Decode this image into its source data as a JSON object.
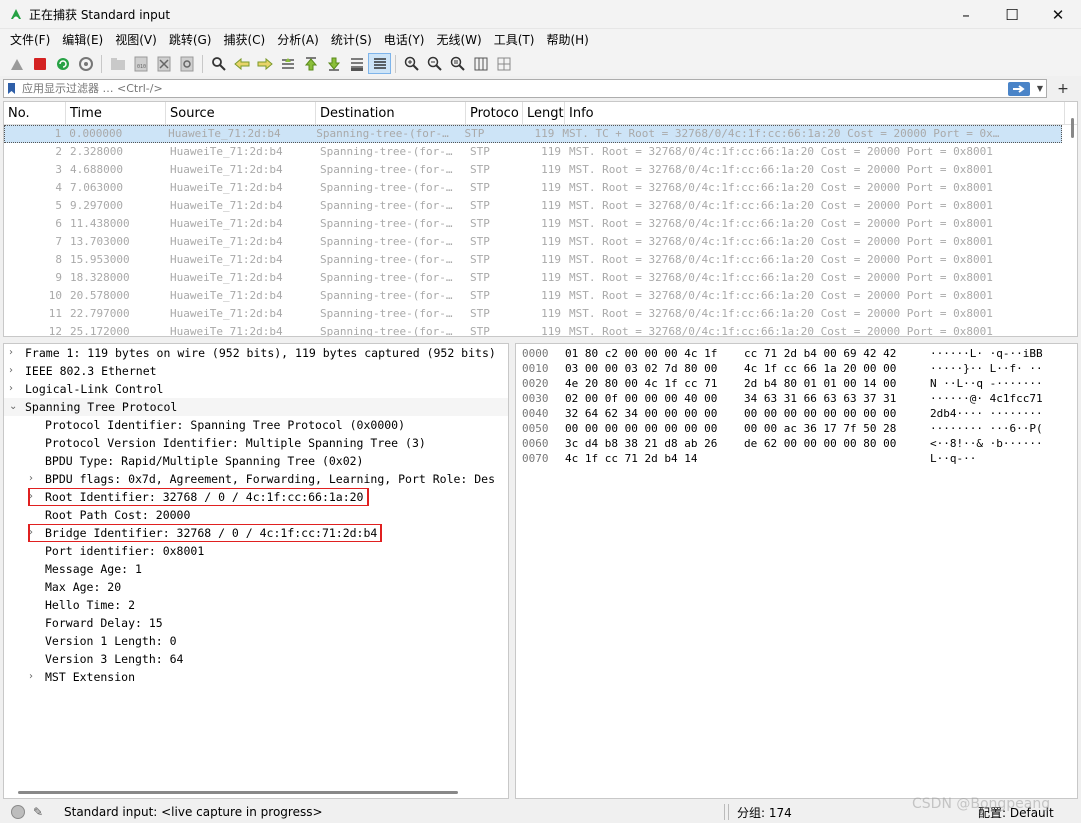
{
  "window": {
    "title": "正在捕获 Standard input",
    "minimize": "–",
    "maximize": "☐",
    "close": "✕",
    "icon": "shark-fin-icon",
    "accent": "#27a245"
  },
  "menu": [
    "文件(F)",
    "编辑(E)",
    "视图(V)",
    "跳转(G)",
    "捕获(C)",
    "分析(A)",
    "统计(S)",
    "电话(Y)",
    "无线(W)",
    "工具(T)",
    "帮助(H)"
  ],
  "toolbar_icons": [
    "start-capture-icon",
    "stop-capture-icon",
    "restart-capture-icon",
    "capture-options-icon",
    "open-file-icon",
    "save-file-icon",
    "close-file-icon",
    "reload-file-icon",
    "find-packet-icon",
    "go-back-icon",
    "go-forward-icon",
    "go-to-packet-icon",
    "first-packet-icon",
    "last-packet-icon",
    "auto-scroll-icon",
    "colorize-icon",
    "zoom-in-icon",
    "zoom-out-icon",
    "normal-size-icon",
    "resize-columns-icon",
    "layout-icon"
  ],
  "filter": {
    "placeholder": "应用显示过滤器 … <Ctrl-/>",
    "add_label": "+"
  },
  "packet_list": {
    "columns": [
      "No.",
      "Time",
      "Source",
      "Destination",
      "Protoco",
      "Lengt",
      "Info"
    ],
    "rows": [
      [
        "1",
        "0.000000",
        "HuaweiTe_71:2d:b4",
        "Spanning-tree-(for-…",
        "STP",
        "119",
        "MST. TC + Root = 32768/0/4c:1f:cc:66:1a:20  Cost = 20000  Port = 0x…"
      ],
      [
        "2",
        "2.328000",
        "HuaweiTe_71:2d:b4",
        "Spanning-tree-(for-…",
        "STP",
        "119",
        "MST. Root = 32768/0/4c:1f:cc:66:1a:20  Cost = 20000  Port = 0x8001"
      ],
      [
        "3",
        "4.688000",
        "HuaweiTe_71:2d:b4",
        "Spanning-tree-(for-…",
        "STP",
        "119",
        "MST. Root = 32768/0/4c:1f:cc:66:1a:20  Cost = 20000  Port = 0x8001"
      ],
      [
        "4",
        "7.063000",
        "HuaweiTe_71:2d:b4",
        "Spanning-tree-(for-…",
        "STP",
        "119",
        "MST. Root = 32768/0/4c:1f:cc:66:1a:20  Cost = 20000  Port = 0x8001"
      ],
      [
        "5",
        "9.297000",
        "HuaweiTe_71:2d:b4",
        "Spanning-tree-(for-…",
        "STP",
        "119",
        "MST. Root = 32768/0/4c:1f:cc:66:1a:20  Cost = 20000  Port = 0x8001"
      ],
      [
        "6",
        "11.438000",
        "HuaweiTe_71:2d:b4",
        "Spanning-tree-(for-…",
        "STP",
        "119",
        "MST. Root = 32768/0/4c:1f:cc:66:1a:20  Cost = 20000  Port = 0x8001"
      ],
      [
        "7",
        "13.703000",
        "HuaweiTe_71:2d:b4",
        "Spanning-tree-(for-…",
        "STP",
        "119",
        "MST. Root = 32768/0/4c:1f:cc:66:1a:20  Cost = 20000  Port = 0x8001"
      ],
      [
        "8",
        "15.953000",
        "HuaweiTe_71:2d:b4",
        "Spanning-tree-(for-…",
        "STP",
        "119",
        "MST. Root = 32768/0/4c:1f:cc:66:1a:20  Cost = 20000  Port = 0x8001"
      ],
      [
        "9",
        "18.328000",
        "HuaweiTe_71:2d:b4",
        "Spanning-tree-(for-…",
        "STP",
        "119",
        "MST. Root = 32768/0/4c:1f:cc:66:1a:20  Cost = 20000  Port = 0x8001"
      ],
      [
        "10",
        "20.578000",
        "HuaweiTe_71:2d:b4",
        "Spanning-tree-(for-…",
        "STP",
        "119",
        "MST. Root = 32768/0/4c:1f:cc:66:1a:20  Cost = 20000  Port = 0x8001"
      ],
      [
        "11",
        "22.797000",
        "HuaweiTe_71:2d:b4",
        "Spanning-tree-(for-…",
        "STP",
        "119",
        "MST. Root = 32768/0/4c:1f:cc:66:1a:20  Cost = 20000  Port = 0x8001"
      ],
      [
        "12",
        "25.172000",
        "HuaweiTe_71:2d:b4",
        "Spanning-tree-(for-…",
        "STP",
        "119",
        "MST. Root = 32768/0/4c:1f:cc:66:1a:20  Cost = 20000  Port = 0x8001"
      ]
    ]
  },
  "details": [
    {
      "text": "Frame 1: 119 bytes on wire (952 bits), 119 bytes captured (952 bits)",
      "arrow": "›"
    },
    {
      "text": "IEEE 802.3 Ethernet",
      "arrow": "›"
    },
    {
      "text": "Logical-Link Control",
      "arrow": "›"
    },
    {
      "text": "Spanning Tree Protocol",
      "arrow": "⌄"
    },
    {
      "text": "Protocol Identifier: Spanning Tree Protocol (0x0000)",
      "arrow": ""
    },
    {
      "text": "Protocol Version Identifier: Multiple Spanning Tree (3)",
      "arrow": ""
    },
    {
      "text": "BPDU Type: Rapid/Multiple Spanning Tree (0x02)",
      "arrow": ""
    },
    {
      "text": "BPDU flags: 0x7d, Agreement, Forwarding, Learning, Port Role: Des",
      "arrow": "›"
    },
    {
      "text": "Root Identifier: 32768 / 0 / 4c:1f:cc:66:1a:20",
      "arrow": "›"
    },
    {
      "text": "Root Path Cost: 20000",
      "arrow": ""
    },
    {
      "text": "Bridge Identifier: 32768 / 0 / 4c:1f:cc:71:2d:b4",
      "arrow": "›"
    },
    {
      "text": "Port identifier: 0x8001",
      "arrow": ""
    },
    {
      "text": "Message Age: 1",
      "arrow": ""
    },
    {
      "text": "Max Age: 20",
      "arrow": ""
    },
    {
      "text": "Hello Time: 2",
      "arrow": ""
    },
    {
      "text": "Forward Delay: 15",
      "arrow": ""
    },
    {
      "text": "Version 1 Length: 0",
      "arrow": ""
    },
    {
      "text": "Version 3 Length: 64",
      "arrow": ""
    },
    {
      "text": "MST Extension",
      "arrow": "›"
    }
  ],
  "bytes": [
    [
      "0000",
      "01 80 c2 00 00 00 4c 1f",
      "cc 71 2d b4 00 69 42 42",
      "······L· ·q-··iBB"
    ],
    [
      "0010",
      "03 00 00 03 02 7d 80 00",
      "4c 1f cc 66 1a 20 00 00",
      "·····}·· L··f· ··"
    ],
    [
      "0020",
      "4e 20 80 00 4c 1f cc 71",
      "2d b4 80 01 01 00 14 00",
      "N ··L··q -·······"
    ],
    [
      "0030",
      "02 00 0f 00 00 00 40 00",
      "34 63 31 66 63 63 37 31",
      "······@· 4c1fcc71"
    ],
    [
      "0040",
      "32 64 62 34 00 00 00 00",
      "00 00 00 00 00 00 00 00",
      "2db4···· ········"
    ],
    [
      "0050",
      "00 00 00 00 00 00 00 00",
      "00 00 ac 36 17 7f 50 28",
      "········ ···6··P("
    ],
    [
      "0060",
      "3c d4 b8 38 21 d8 ab 26",
      "de 62 00 00 00 00 80 00",
      "<··8!··& ·b······"
    ],
    [
      "0070",
      "4c 1f cc 71 2d b4 14",
      "",
      "L··q-··"
    ]
  ],
  "status": {
    "text": "Standard input: <live capture in progress>",
    "packets": "分组: 174",
    "profile": "配置: Default"
  },
  "watermark": "CSDN @Bongpeang"
}
